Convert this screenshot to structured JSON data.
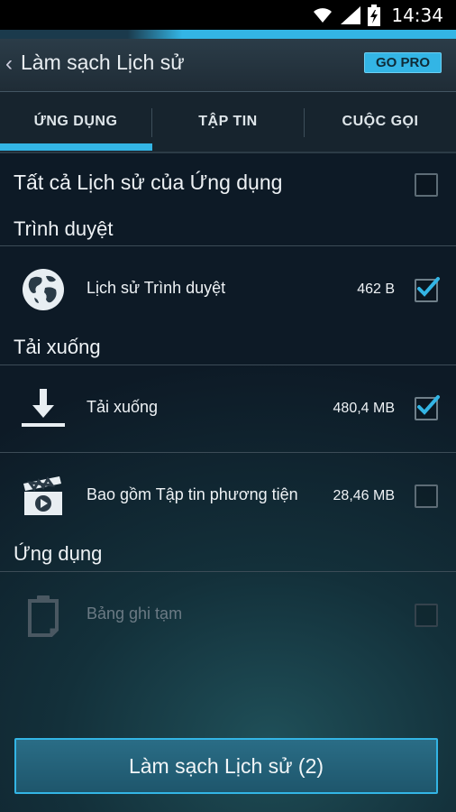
{
  "status_bar": {
    "time": "14:34"
  },
  "action_bar": {
    "back_glyph": "‹",
    "title": "Làm sạch Lịch sử",
    "go_pro": "GO PRO"
  },
  "tabs": [
    {
      "label": "ỨNG DỤNG",
      "selected": true
    },
    {
      "label": "TẬP TIN",
      "selected": false
    },
    {
      "label": "CUỘC GỌI",
      "selected": false
    }
  ],
  "select_all": {
    "label": "Tất cả Lịch sử của Ứng dụng",
    "checked": false
  },
  "sections": [
    {
      "title": "Trình duyệt",
      "items": [
        {
          "name": "Lịch sử Trình duyệt",
          "size": "462 B",
          "checked": true,
          "icon": "globe-icon",
          "enabled": true
        }
      ]
    },
    {
      "title": "Tải xuống",
      "items": [
        {
          "name": "Tải xuống",
          "size": "480,4 MB",
          "checked": true,
          "icon": "download-icon",
          "enabled": true
        },
        {
          "name": "Bao gồm Tập tin phương tiện",
          "size": "28,46 MB",
          "checked": false,
          "icon": "clapperboard-icon",
          "enabled": true
        }
      ]
    },
    {
      "title": "Ứng dụng",
      "items": [
        {
          "name": "Bảng ghi tạm",
          "size": "",
          "checked": false,
          "icon": "clipboard-icon",
          "enabled": false
        }
      ]
    }
  ],
  "action_button": {
    "label": "Làm sạch Lịch sử (2)"
  },
  "colors": {
    "accent": "#33b5e5",
    "background": "#13303a"
  }
}
